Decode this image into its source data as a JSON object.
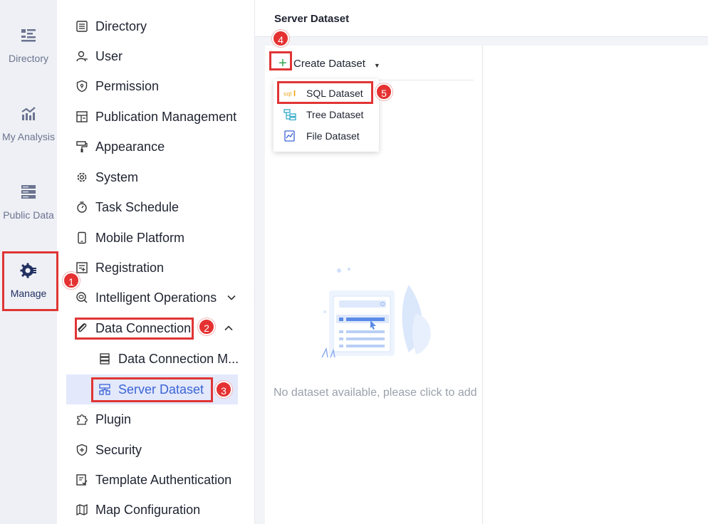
{
  "rail": {
    "items": [
      {
        "label": "Directory",
        "icon": "list-icon"
      },
      {
        "label": "My Analysis",
        "icon": "analysis-chart-icon"
      },
      {
        "label": "Public Data",
        "icon": "database-icon"
      },
      {
        "label": "Manage",
        "icon": "gear-manage-icon"
      }
    ]
  },
  "nav": {
    "items": [
      {
        "label": "Directory"
      },
      {
        "label": "User"
      },
      {
        "label": "Permission"
      },
      {
        "label": "Publication Management"
      },
      {
        "label": "Appearance"
      },
      {
        "label": "System"
      },
      {
        "label": "Task Schedule"
      },
      {
        "label": "Mobile Platform"
      },
      {
        "label": "Registration"
      },
      {
        "label": "Intelligent Operations"
      },
      {
        "label": "Data Connection"
      },
      {
        "label": "Data Connection M..."
      },
      {
        "label": "Server Dataset"
      },
      {
        "label": "Plugin"
      },
      {
        "label": "Security"
      },
      {
        "label": "Template Authentication"
      },
      {
        "label": "Map Configuration"
      }
    ]
  },
  "main": {
    "title": "Server Dataset",
    "create_label": "Create Dataset",
    "menu": [
      {
        "label": "SQL Dataset",
        "icon": "sql-icon"
      },
      {
        "label": "Tree Dataset",
        "icon": "tree-dataset-icon"
      },
      {
        "label": "File Dataset",
        "icon": "file-dataset-icon"
      }
    ],
    "empty_text": "No dataset available, please click to add"
  },
  "annotations": {
    "badges": [
      "1",
      "2",
      "3",
      "4",
      "5"
    ]
  },
  "colors": {
    "accent": "#3b64d6",
    "annotation_red": "#e03535",
    "selected_bg": "#e3e9fb",
    "rail_bg": "#eef0f5",
    "plus_green": "#2fa84f"
  }
}
